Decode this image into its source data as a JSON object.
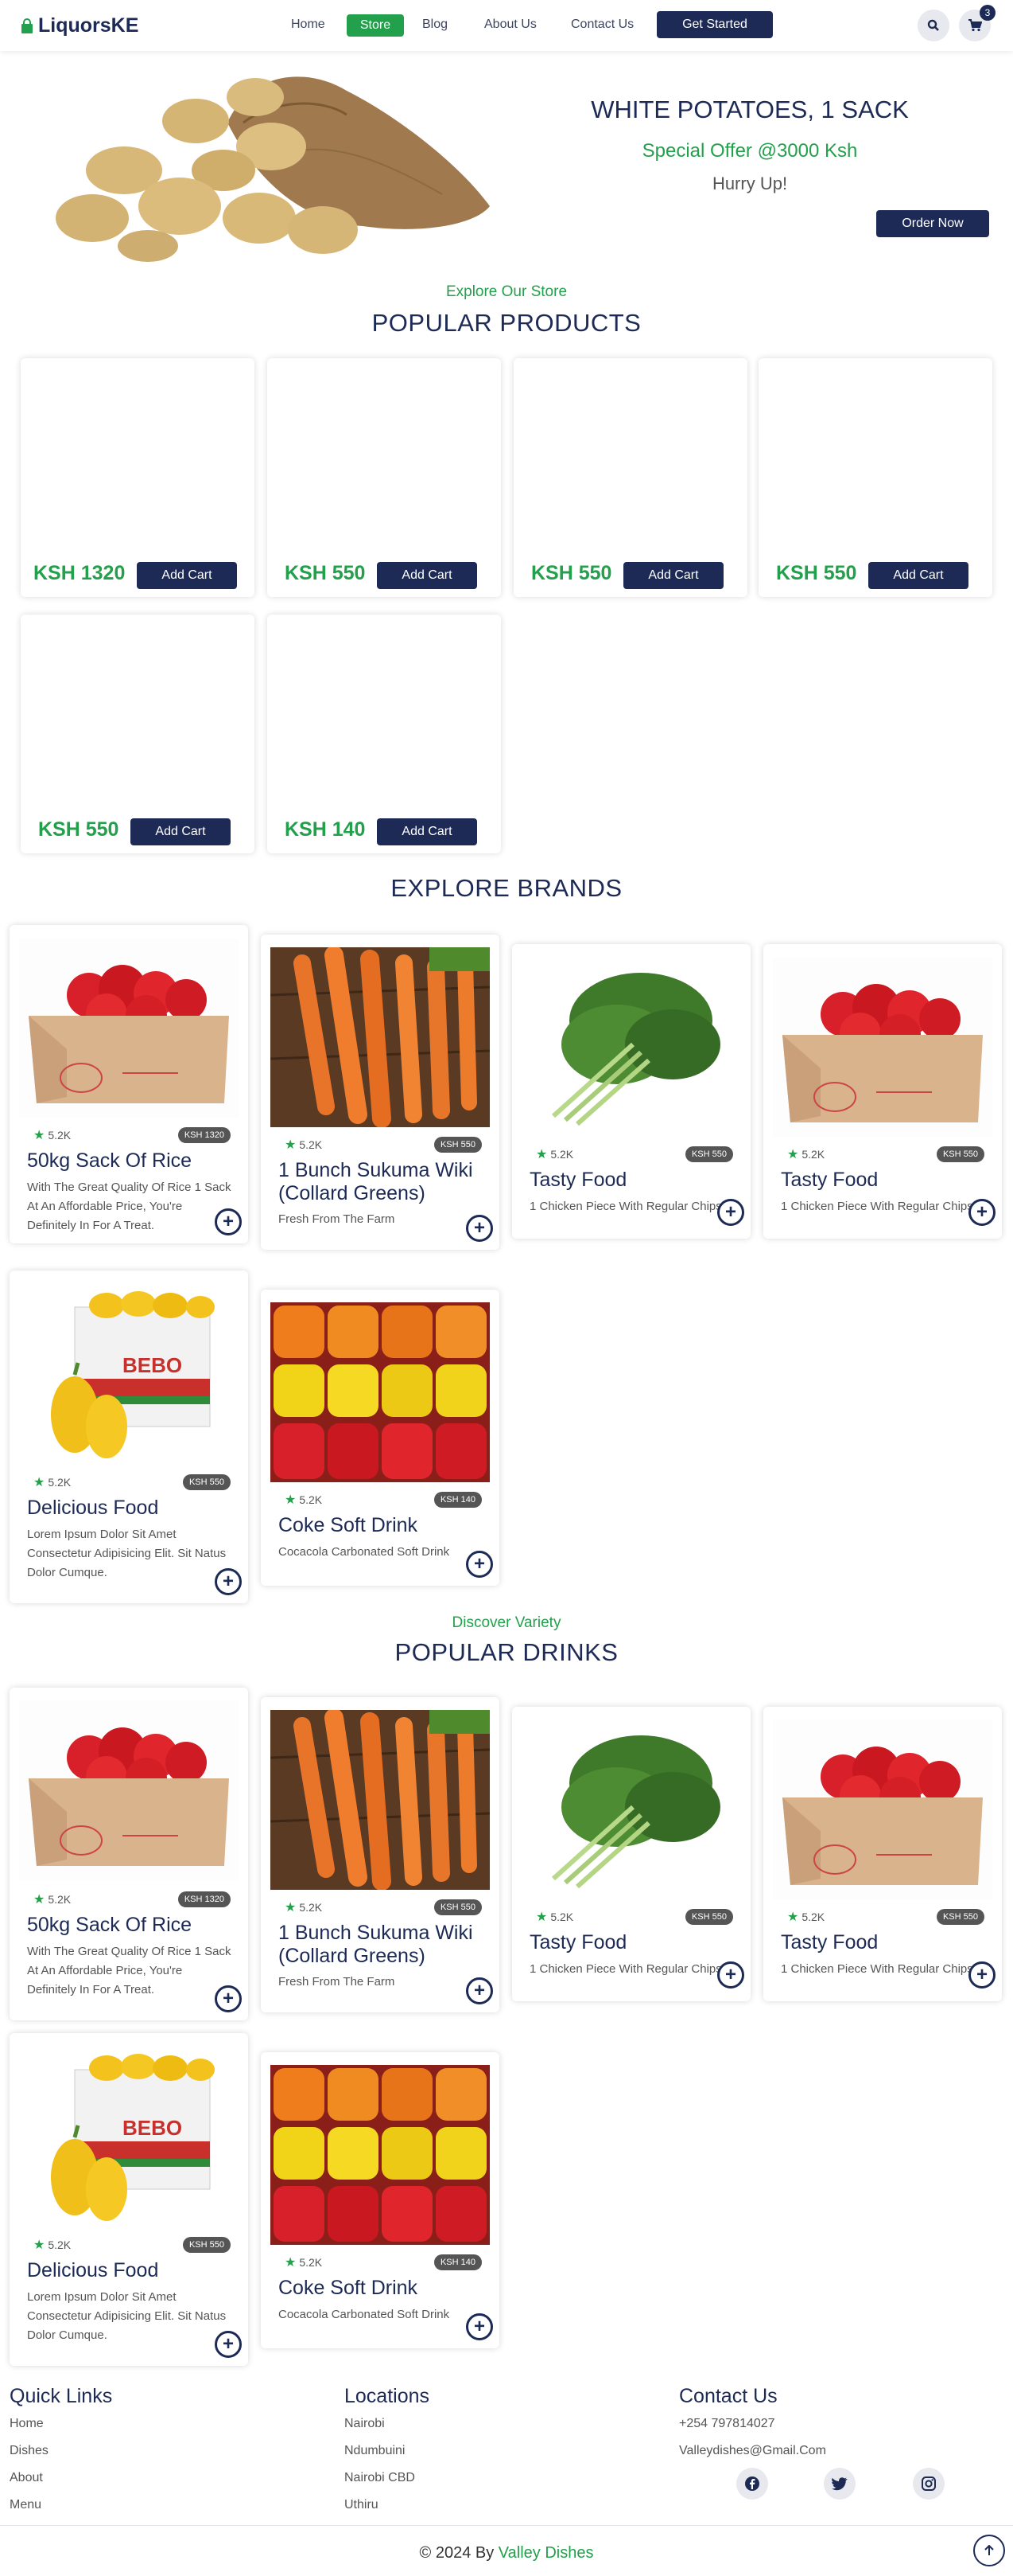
{
  "nav": {
    "brand": "LiquorsKE",
    "links": [
      "Home",
      "Store",
      "Blog",
      "About Us",
      "Contact Us"
    ],
    "cta": "Get Started",
    "cart_count": "3",
    "icons": [
      "search-icon",
      "cart-icon"
    ]
  },
  "hero": {
    "title": "WHITE POTATOES, 1 SACK",
    "offer": "Special Offer @3000 Ksh",
    "hurry": "Hurry Up!",
    "order_label": "Order Now"
  },
  "popular_products": {
    "eyebrow": "Explore Our Store",
    "title": "POPULAR PRODUCTS",
    "add_label": "Add Cart",
    "prices": [
      "KSH 1320",
      "KSH 550",
      "KSH 550",
      "KSH 550",
      "KSH 550",
      "KSH 140"
    ]
  },
  "brands": {
    "title": "EXPLORE BRANDS",
    "items": [
      {
        "rating": "5.2K",
        "price": "KSH 1320",
        "title": "50kg Sack Of Rice",
        "desc": "With The Great Quality Of Rice 1 Sack At An Affordable Price, You're Definitely In For A Treat.",
        "image": "red-peppers-box"
      },
      {
        "rating": "5.2K",
        "price": "KSH 550",
        "title": "1 Bunch Sukuma Wiki (Collard Greens)",
        "desc": "Fresh From The Farm",
        "image": "carrots"
      },
      {
        "rating": "5.2K",
        "price": "KSH 550",
        "title": "Tasty Food",
        "desc": "1 Chicken Piece With Regular Chips",
        "image": "collard-greens"
      },
      {
        "rating": "5.2K",
        "price": "KSH 550",
        "title": "Tasty Food",
        "desc": "1 Chicken Piece With Regular Chips",
        "image": "red-peppers-box"
      },
      {
        "rating": "5.2K",
        "price": "KSH 550",
        "title": "Delicious Food",
        "desc": "Lorem Ipsum Dolor Sit Amet Consectetur Adipisicing Elit. Sit Natus Dolor Cumque.",
        "image": "yellow-peppers-box"
      },
      {
        "rating": "5.2K",
        "price": "KSH 140",
        "title": "Coke Soft Drink",
        "desc": "Cocacola Carbonated Soft Drink",
        "image": "mixed-peppers"
      }
    ]
  },
  "drinks": {
    "eyebrow": "Discover Variety",
    "title": "POPULAR DRINKS",
    "items": [
      {
        "rating": "5.2K",
        "price": "KSH 1320",
        "title": "50kg Sack Of Rice",
        "desc": "With The Great Quality Of Rice 1 Sack At An Affordable Price, You're Definitely In For A Treat.",
        "image": "red-peppers-box"
      },
      {
        "rating": "5.2K",
        "price": "KSH 550",
        "title": "1 Bunch Sukuma Wiki (Collard Greens)",
        "desc": "Fresh From The Farm",
        "image": "carrots"
      },
      {
        "rating": "5.2K",
        "price": "KSH 550",
        "title": "Tasty Food",
        "desc": "1 Chicken Piece With Regular Chips",
        "image": "collard-greens"
      },
      {
        "rating": "5.2K",
        "price": "KSH 550",
        "title": "Tasty Food",
        "desc": "1 Chicken Piece With Regular Chips",
        "image": "red-peppers-box"
      },
      {
        "rating": "5.2K",
        "price": "KSH 550",
        "title": "Delicious Food",
        "desc": "Lorem Ipsum Dolor Sit Amet Consectetur Adipisicing Elit. Sit Natus Dolor Cumque.",
        "image": "yellow-peppers-box"
      },
      {
        "rating": "5.2K",
        "price": "KSH 140",
        "title": "Coke Soft Drink",
        "desc": "Cocacola Carbonated Soft Drink",
        "image": "mixed-peppers"
      }
    ]
  },
  "footer": {
    "quick_title": "Quick Links",
    "quick_links": [
      "Home",
      "Dishes",
      "About",
      "Menu"
    ],
    "loc_title": "Locations",
    "locations": [
      "Nairobi",
      "Ndumbuini",
      "Nairobi CBD",
      "Uthiru"
    ],
    "contact_title": "Contact Us",
    "phone": "+254 797814027",
    "email": "Valleydishes@Gmail.Com",
    "socials": [
      "facebook-icon",
      "twitter-icon",
      "instagram-icon"
    ],
    "copyright_prefix": "© 2024 By",
    "copyright_name": "Valley Dishes"
  },
  "colors": {
    "navy": "#1c2a55",
    "green": "#22a04b",
    "badge": "#555555"
  }
}
